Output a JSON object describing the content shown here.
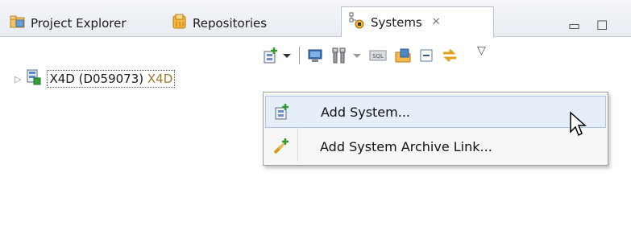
{
  "tabs": [
    {
      "label": "Project Explorer",
      "icon": "project-explorer-icon"
    },
    {
      "label": "Repositories",
      "icon": "repositories-icon"
    },
    {
      "label": "Systems",
      "icon": "systems-icon",
      "active": true,
      "close": "✕"
    }
  ],
  "window_controls": {
    "minimize": "▭",
    "maximize": "☐"
  },
  "toolbar": {
    "items": [
      "add-system-icon",
      "dropdown-arrow-icon",
      "monitor-icon",
      "tools-icon",
      "dropdown-arrow-icon",
      "sql-icon",
      "folder-icon",
      "collapse-all-icon",
      "link-editor-icon"
    ],
    "view_menu": "▽"
  },
  "tree": {
    "expander": "▷",
    "item_name": "X4D (D059073)",
    "item_extra": "X4D"
  },
  "context_menu": {
    "items": [
      {
        "label": "Add System...",
        "icon": "add-system-icon",
        "highlighted": true
      },
      {
        "label": "Add System Archive Link...",
        "icon": "add-archive-link-icon",
        "highlighted": false
      }
    ]
  },
  "colors": {
    "highlight": "#e5eef9",
    "highlight_border": "#a9c5ea",
    "tree_extra": "#9a7a2a"
  }
}
